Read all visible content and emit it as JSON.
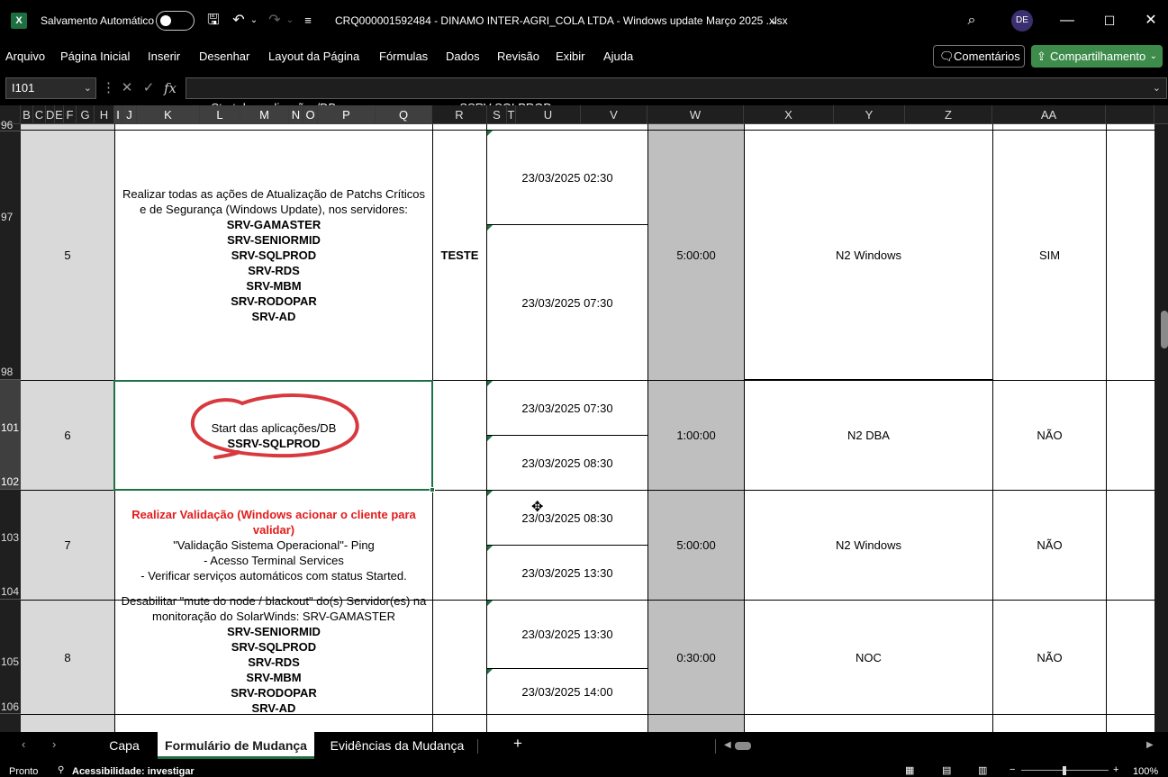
{
  "titlebar": {
    "autosave_label": "Salvamento Automático",
    "doc_title": "CRQ000001592484  - DINAMO INTER-AGRI_COLA LTDA - Windows update Março 2025 .xlsx",
    "avatar_initials": "DE"
  },
  "menu": [
    "Arquivo",
    "Página Inicial",
    "Inserir",
    "Desenhar",
    "Layout da Página",
    "Fórmulas",
    "Dados",
    "Revisão",
    "Exibir",
    "Ajuda"
  ],
  "menu_buttons": {
    "comments": "Comentários",
    "share": "Compartilhamento"
  },
  "formula_bar": {
    "name_box": "I101",
    "fx_label": "fx",
    "formula": "Start das aplicações/DB                                      SSRV-SQLPROD"
  },
  "columns": [
    "B",
    "C",
    "D",
    "E",
    "F",
    "G",
    "H",
    "I",
    "J",
    "K",
    "L",
    "M",
    "N",
    "O",
    "P",
    "Q",
    "R",
    "S",
    "T",
    "U",
    "V",
    "W",
    "X",
    "Y",
    "Z",
    "AA"
  ],
  "row_numbers": [
    "96",
    "97",
    "98",
    "101",
    "102",
    "103",
    "104",
    "105",
    "106"
  ],
  "rows": [
    {
      "step": "5",
      "desc_lines": [
        "Realizar todas as ações de Atualização de Patchs Críticos",
        "e de Segurança (Windows Update), nos servidores:"
      ],
      "servers": [
        "SRV-GAMASTER",
        "SRV-SENIORMID",
        "SRV-SQLPROD",
        "SRV-RDS",
        "SRV-MBM",
        "SRV-RODOPAR",
        "SRV-AD"
      ],
      "r": "TESTE",
      "start": "23/03/2025 02:30",
      "end": "23/03/2025 07:30",
      "duration": "5:00:00",
      "team": "N2 Windows",
      "aa": "SIM"
    },
    {
      "step": "6",
      "desc_lines": [
        "Start das aplicações/DB"
      ],
      "servers": [
        "SSRV-SQLPROD"
      ],
      "r": "",
      "start": "23/03/2025 07:30",
      "end": "23/03/2025 08:30",
      "duration": "1:00:00",
      "team": "N2 DBA",
      "aa": "NÃO"
    },
    {
      "step": "7",
      "title": "Realizar Validação (Windows acionar o cliente para validar)",
      "desc_lines": [
        "\"Validação Sistema Operacional\"- Ping",
        "- Acesso Terminal Services",
        "- Verificar serviços automáticos com status Started."
      ],
      "r": "",
      "start": "23/03/2025 08:30",
      "end": "23/03/2025 13:30",
      "duration": "5:00:00",
      "team": "N2 Windows",
      "aa": "NÃO"
    },
    {
      "step": "8",
      "desc_lines": [
        "Desabilitar \"mute do node / blackout\" do(s) Servidor(es) na",
        "monitoração do SolarWinds: SRV-GAMASTER"
      ],
      "servers": [
        "SRV-SENIORMID",
        "SRV-SQLPROD",
        "SRV-RDS",
        "SRV-MBM",
        "SRV-RODOPAR",
        "SRV-AD"
      ],
      "r": "",
      "start": "23/03/2025 13:30",
      "end": "23/03/2025 14:00",
      "duration": "0:30:00",
      "team": "NOC",
      "aa": "NÃO"
    }
  ],
  "sheet_tabs": [
    "Capa",
    "Formulário de Mudança",
    "Evidências da Mudança"
  ],
  "active_tab": "Formulário de Mudança",
  "status": {
    "ready": "Pronto",
    "accessibility": "Acessibilidade: investigar",
    "zoom": "100%"
  }
}
